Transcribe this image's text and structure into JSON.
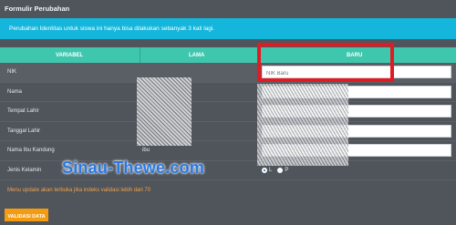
{
  "panel": {
    "title": "Formulir Perubahan"
  },
  "notice": {
    "text": "Perubahan Identitas untuk siswa ini hanya bisa dilakukan sebanyak 3 kali lagi."
  },
  "table": {
    "headers": [
      "VARIABEL",
      "LAMA",
      "BARU"
    ],
    "rows": [
      {
        "label": "NIK",
        "old": "",
        "new": "NIK Baru"
      },
      {
        "label": "Nama",
        "old": "",
        "new": ""
      },
      {
        "label": "Tempat Lahir",
        "old": "",
        "new": ""
      },
      {
        "label": "Tanggal Lahir",
        "old": "",
        "new": ""
      },
      {
        "label": "Nama Ibu Kandung",
        "old": "ibu",
        "new": ""
      },
      {
        "label": "Jenis Kelamin",
        "old": "",
        "new": ""
      }
    ],
    "gender_options": [
      "L",
      "P"
    ],
    "gender_selected": "L"
  },
  "menu_note": "Menu update akan terbuka jika indeks validasi lebih dari 70",
  "validate_button": "VALIDASI DATA",
  "watermark": "Sinau-Thewe.com",
  "colors": {
    "background": "#50555c",
    "notice": "#14b6dc",
    "table_header": "#3ec7ad",
    "button": "#f39c12",
    "highlight": "#e11b24",
    "menu_note": "#f0a24a"
  }
}
